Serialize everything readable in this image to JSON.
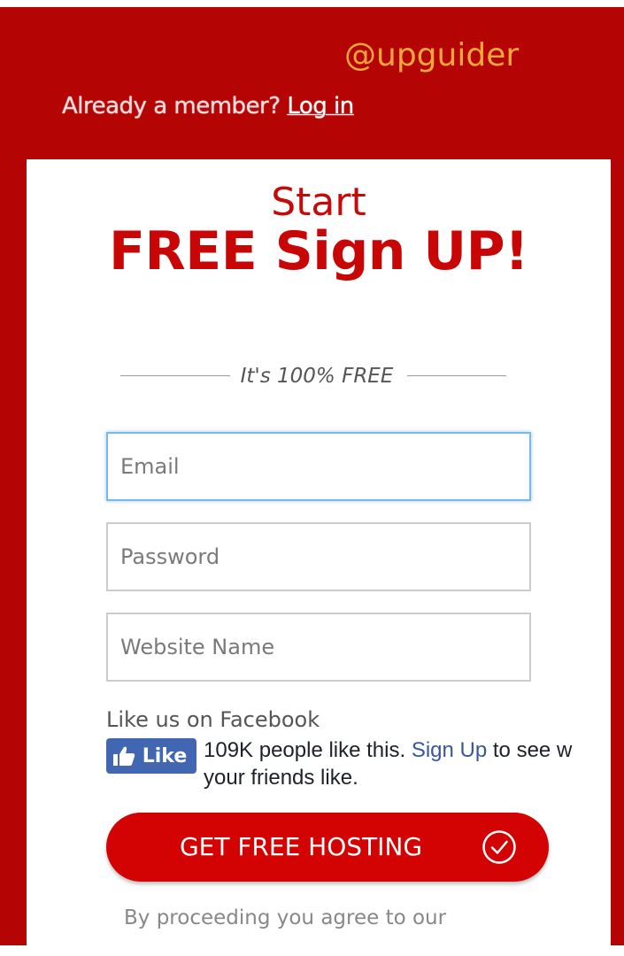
{
  "watermark": "@upguider",
  "header": {
    "member_prompt": "Already a member?",
    "login_link": "Log in"
  },
  "hero": {
    "start": "Start",
    "headline": "FREE Sign UP!",
    "free_note": "It's 100% FREE"
  },
  "form": {
    "email_placeholder": "Email",
    "password_placeholder": "Password",
    "website_placeholder": "Website Name"
  },
  "facebook": {
    "title": "Like us on Facebook",
    "like_label": "Like",
    "like_icon": "thumbs-up-icon",
    "count_text": "109K people like this.",
    "signup_link": "Sign Up",
    "after_text": "to see w",
    "line2": "your friends like."
  },
  "cta": {
    "label": "GET FREE HOSTING",
    "icon": "check-circle-icon"
  },
  "terms": "By proceeding you agree to our",
  "colors": {
    "brand_red": "#b50404",
    "button_red": "#d30303",
    "facebook_blue": "#4267b2",
    "watermark_orange": "#f0a63a"
  }
}
